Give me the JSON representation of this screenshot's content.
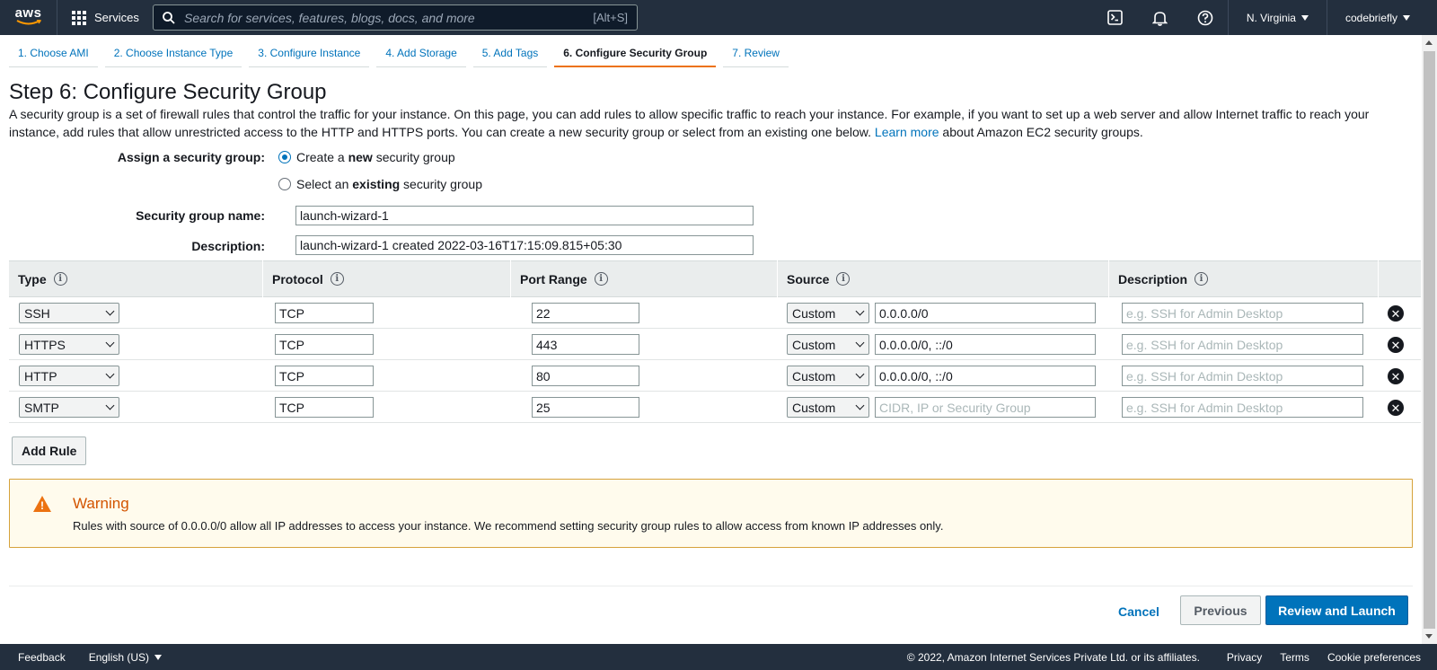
{
  "topnav": {
    "logo_text": "aws",
    "services_label": "Services",
    "search_placeholder": "Search for services, features, blogs, docs, and more",
    "search_shortcut": "[Alt+S]",
    "region": "N. Virginia",
    "account": "codebriefly",
    "icons": [
      "cloudshell-icon",
      "bell-icon",
      "help-icon"
    ]
  },
  "wizard_tabs": [
    {
      "label": "1. Choose AMI",
      "active": false
    },
    {
      "label": "2. Choose Instance Type",
      "active": false
    },
    {
      "label": "3. Configure Instance",
      "active": false
    },
    {
      "label": "4. Add Storage",
      "active": false
    },
    {
      "label": "5. Add Tags",
      "active": false
    },
    {
      "label": "6. Configure Security Group",
      "active": true
    },
    {
      "label": "7. Review",
      "active": false
    }
  ],
  "page": {
    "title": "Step 6: Configure Security Group",
    "intro_text": "A security group is a set of firewall rules that control the traffic for your instance. On this page, you can add rules to allow specific traffic to reach your instance. For example, if you want to set up a web server and allow Internet traffic to reach your instance, add rules that allow unrestricted access to the HTTP and HTTPS ports. You can create a new security group or select from an existing one below.",
    "learn_more": "Learn more",
    "intro_suffix": "about Amazon EC2 security groups."
  },
  "form": {
    "assign_label": "Assign a security group:",
    "option_new_pre": "Create a ",
    "option_new_bold": "new",
    "option_new_post": " security group",
    "option_existing_pre": "Select an ",
    "option_existing_bold": "existing",
    "option_existing_post": " security group",
    "selected_option": "new",
    "name_label": "Security group name:",
    "name_value": "launch-wizard-1",
    "desc_label": "Description:",
    "desc_value": "launch-wizard-1 created 2022-03-16T17:15:09.815+05:30"
  },
  "table": {
    "headers": [
      "Type",
      "Protocol",
      "Port Range",
      "Source",
      "Description"
    ],
    "rows": [
      {
        "type": "SSH",
        "protocol": "TCP",
        "port": "22",
        "source_mode": "Custom",
        "source": "0.0.0.0/0",
        "source_placeholder": "CIDR, IP or Security Group",
        "desc": "",
        "desc_placeholder": "e.g. SSH for Admin Desktop"
      },
      {
        "type": "HTTPS",
        "protocol": "TCP",
        "port": "443",
        "source_mode": "Custom",
        "source": "0.0.0.0/0, ::/0",
        "source_placeholder": "CIDR, IP or Security Group",
        "desc": "",
        "desc_placeholder": "e.g. SSH for Admin Desktop"
      },
      {
        "type": "HTTP",
        "protocol": "TCP",
        "port": "80",
        "source_mode": "Custom",
        "source": "0.0.0.0/0, ::/0",
        "source_placeholder": "CIDR, IP or Security Group",
        "desc": "",
        "desc_placeholder": "e.g. SSH for Admin Desktop"
      },
      {
        "type": "SMTP",
        "protocol": "TCP",
        "port": "25",
        "source_mode": "Custom",
        "source": "",
        "source_placeholder": "CIDR, IP or Security Group",
        "desc": "",
        "desc_placeholder": "e.g. SSH for Admin Desktop"
      }
    ],
    "add_rule_label": "Add Rule",
    "delete_symbol": "✕"
  },
  "warning": {
    "title": "Warning",
    "text": "Rules with source of 0.0.0.0/0 allow all IP addresses to access your instance. We recommend setting security group rules to allow access from known IP addresses only.",
    "icon_symbol": "!"
  },
  "actions": {
    "cancel": "Cancel",
    "previous": "Previous",
    "review_launch": "Review and Launch"
  },
  "footer": {
    "feedback": "Feedback",
    "language": "English (US)",
    "copyright": "© 2022, Amazon Internet Services Private Ltd. or its affiliates.",
    "privacy": "Privacy",
    "terms": "Terms",
    "cookies": "Cookie preferences"
  }
}
